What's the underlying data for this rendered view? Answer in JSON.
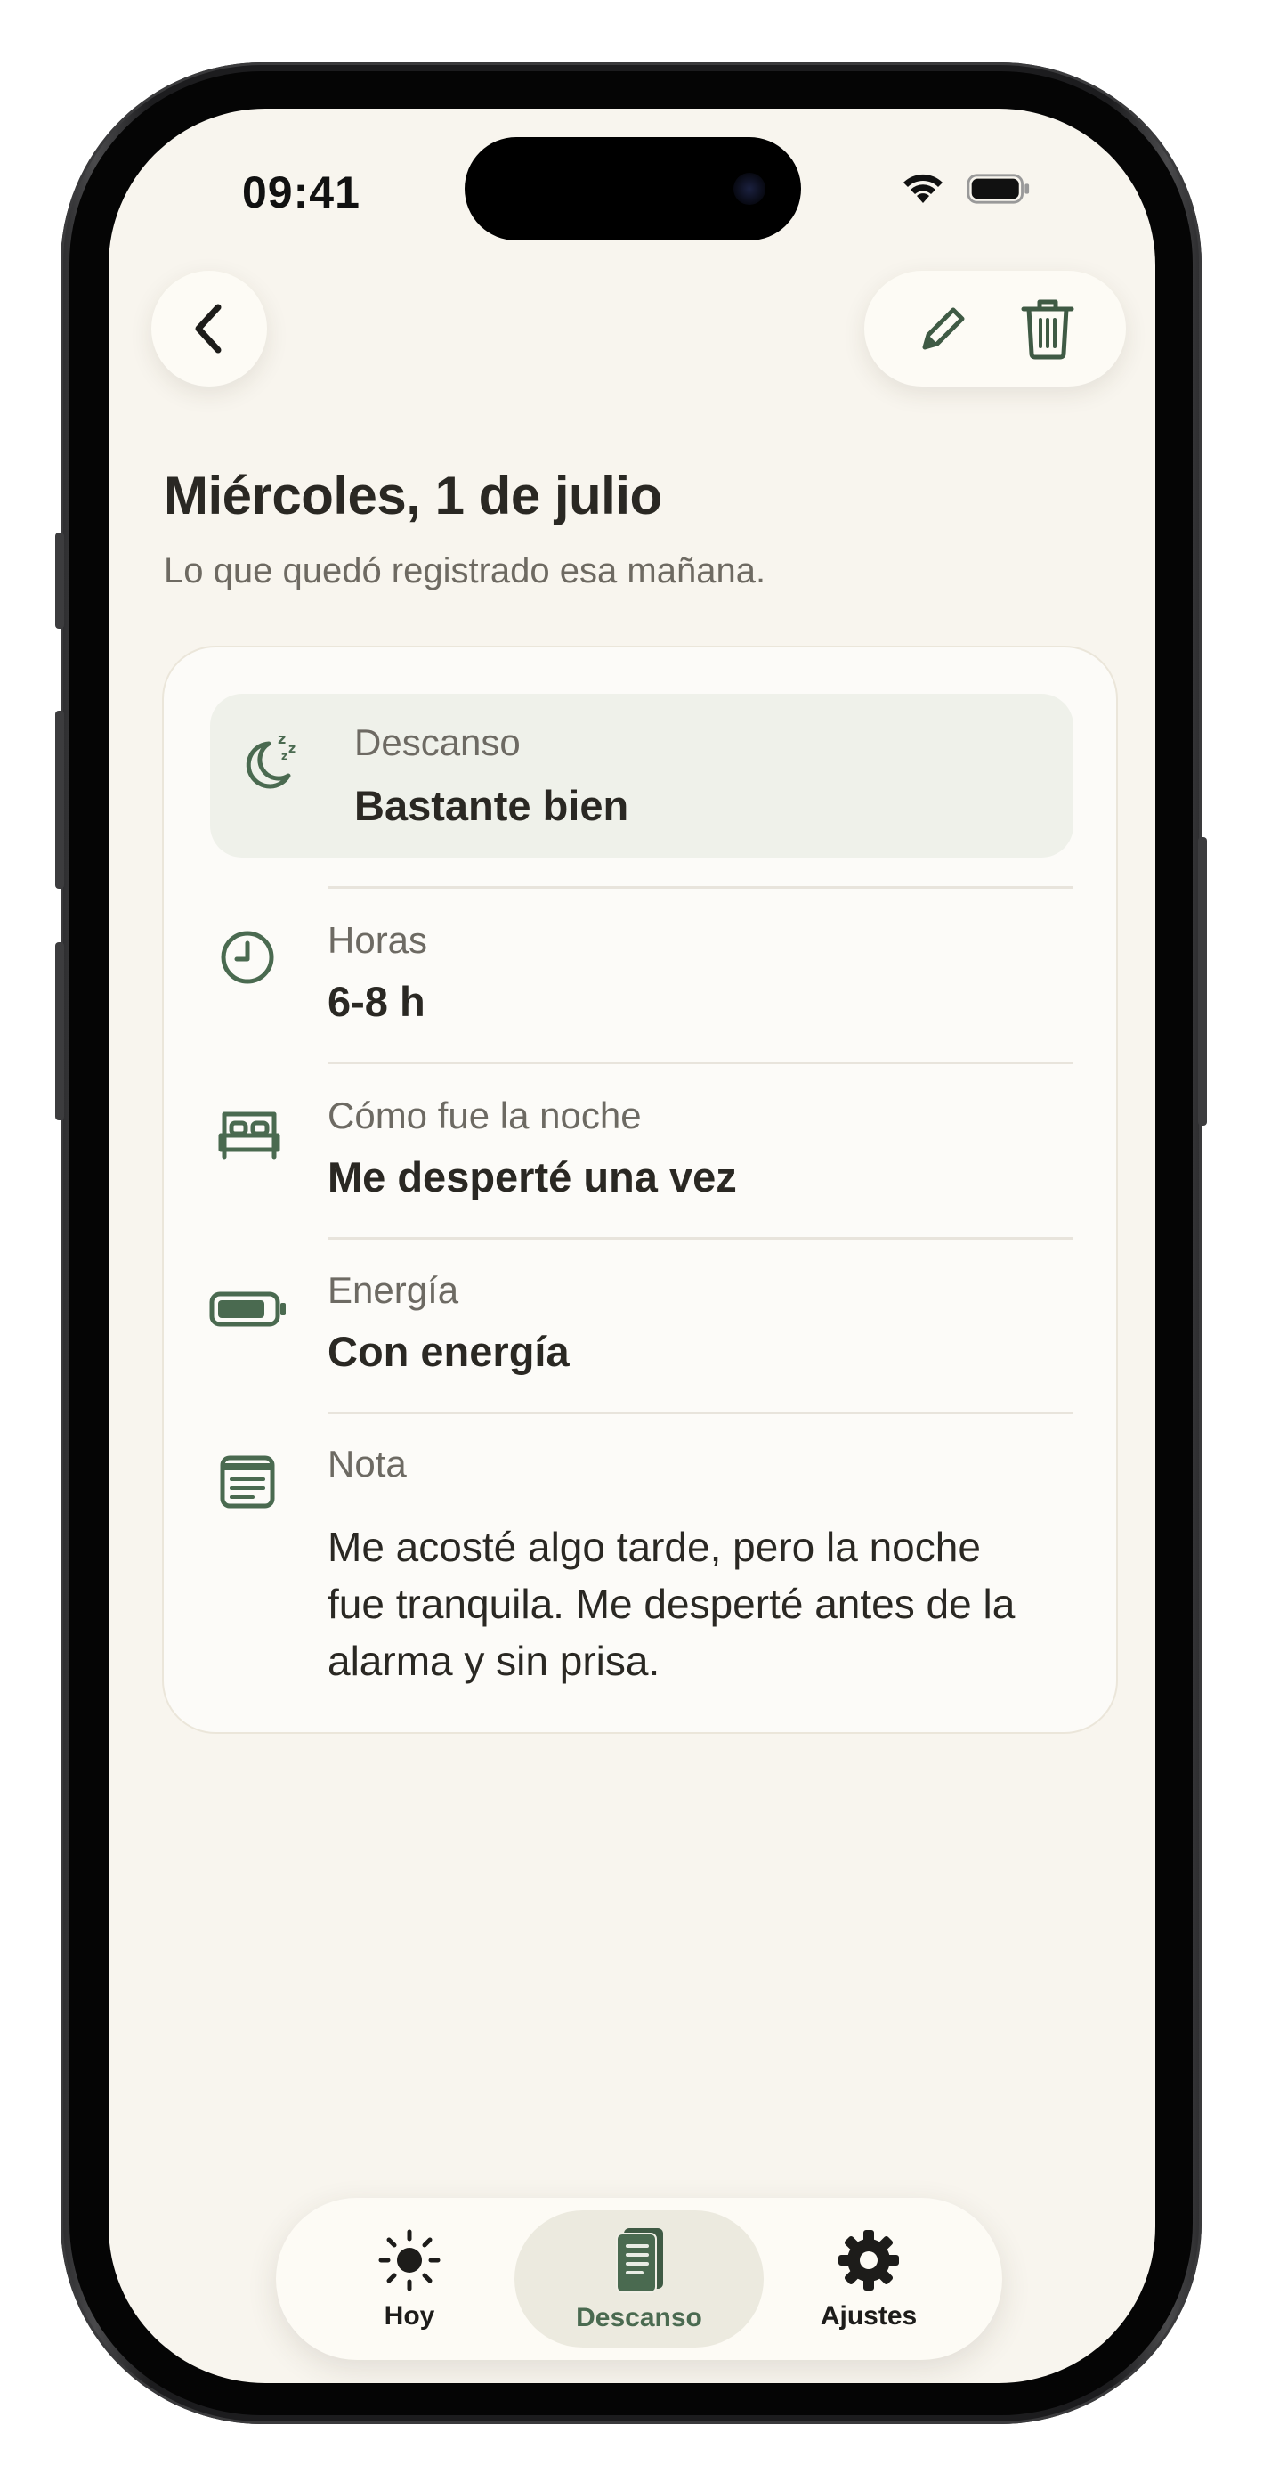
{
  "status_bar": {
    "time": "09:41"
  },
  "header": {
    "back_icon": "chevron-left-icon",
    "edit_icon": "pencil-icon",
    "delete_icon": "trash-icon"
  },
  "page": {
    "title": "Miércoles, 1 de julio",
    "subtitle": "Lo que quedó registrado esa mañana."
  },
  "entry": {
    "rows": [
      {
        "icon": "moon-sleep-icon",
        "label": "Descanso",
        "value": "Bastante bien"
      },
      {
        "icon": "clock-icon",
        "label": "Horas",
        "value": "6-8 h"
      },
      {
        "icon": "bed-icon",
        "label": "Cómo fue la noche",
        "value": "Me desperté una vez"
      },
      {
        "icon": "battery-icon",
        "label": "Energía",
        "value": "Con energía"
      },
      {
        "icon": "note-icon",
        "label": "Nota",
        "value": "Me acosté algo tarde, pero la noche fue tranquila. Me desperté antes de la alarma y sin prisa."
      }
    ]
  },
  "tabbar": {
    "tabs": [
      {
        "icon": "sun-icon",
        "label": "Hoy"
      },
      {
        "icon": "journal-icon",
        "label": "Descanso",
        "active": true
      },
      {
        "icon": "gear-icon",
        "label": "Ajustes"
      }
    ]
  },
  "colors": {
    "accent": "#4a6a50",
    "background": "#f8f5ee",
    "card": "#fcfbf8",
    "highlight": "#eff1ea"
  }
}
